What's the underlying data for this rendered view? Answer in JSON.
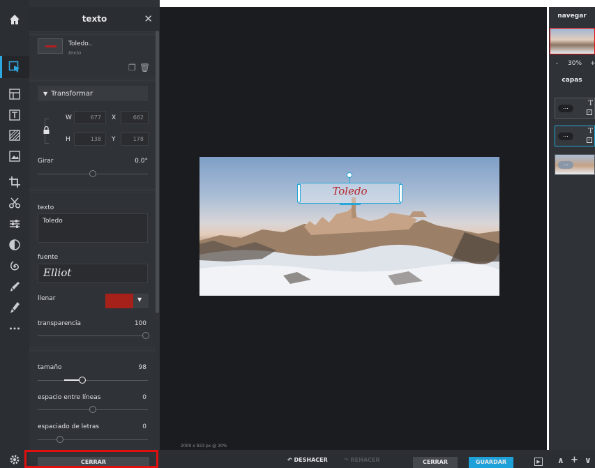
{
  "panel": {
    "title": "texto",
    "close": "✕",
    "layer": {
      "name": "Toledo..",
      "type": "texto"
    },
    "transform_header": "Transformar",
    "w_label": "W",
    "w_value": "677",
    "x_label": "X",
    "x_value": "662",
    "h_label": "H",
    "h_value": "138",
    "y_label": "Y",
    "y_value": "178",
    "rotate_label": "Girar",
    "rotate_value": "0.0°",
    "text_label": "texto",
    "text_value": "Toledo",
    "font_label": "fuente",
    "font_value": "Elliot",
    "fill_label": "llenar",
    "fill_color": "#a6211a",
    "opacity_label": "transparencia",
    "opacity_value": "100",
    "size_label": "tamaño",
    "size_value": "98",
    "line_spacing_label": "espacio entre líneas",
    "line_spacing_value": "0",
    "letter_spacing_label": "espaciado de letras",
    "letter_spacing_value": "0",
    "close_button": "CERRAR"
  },
  "canvas": {
    "status": "2000 x 923 px @ 30%",
    "text_on_image": "Toledo"
  },
  "bottombar": {
    "undo": "DESHACER",
    "redo": "REHACER",
    "close": "CERRAR",
    "save": "GUARDAR",
    "up": "∧",
    "plus": "+",
    "down": "∨"
  },
  "right": {
    "navigate_title": "navegar",
    "zoom_minus": "-",
    "zoom_value": "30%",
    "zoom_plus": "+",
    "layers_title": "capas",
    "layer_text_glyph": "T"
  },
  "colors": {
    "accent": "#2ea8e0",
    "highlight": "#e01010",
    "save": "#1ea0d8"
  },
  "icons": [
    "home-icon",
    "select-icon",
    "layout-icon",
    "text-icon",
    "pattern-icon",
    "image-icon",
    "crop-icon",
    "cut-icon",
    "adjust-icon",
    "contrast-icon",
    "spiral-icon",
    "brush-icon",
    "pen-icon",
    "more-icon",
    "gear-icon"
  ]
}
